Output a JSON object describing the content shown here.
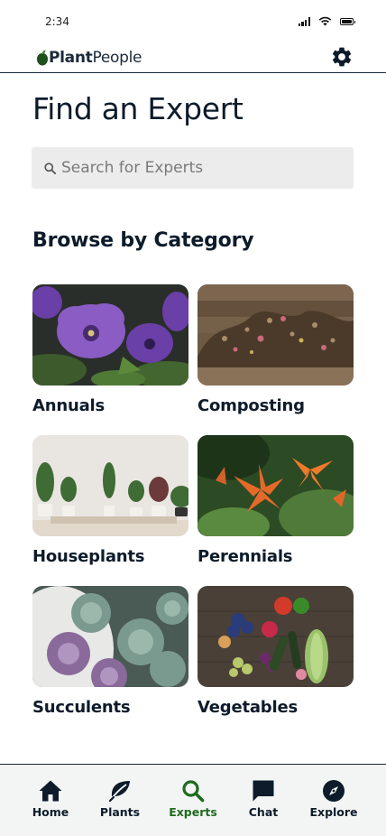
{
  "status_bar": {
    "time": "2:34"
  },
  "header": {
    "logo_part1": "Plant",
    "logo_part2": "People"
  },
  "main": {
    "title": "Find an Expert",
    "search": {
      "placeholder": "Search for Experts",
      "value": ""
    },
    "section_title": "Browse by Category",
    "categories": [
      {
        "label": "Annuals"
      },
      {
        "label": "Composting"
      },
      {
        "label": "Houseplants"
      },
      {
        "label": "Perennials"
      },
      {
        "label": "Succulents"
      },
      {
        "label": "Vegetables"
      }
    ]
  },
  "bottom_nav": {
    "items": [
      {
        "label": "Home",
        "icon": "home-icon"
      },
      {
        "label": "Plants",
        "icon": "leaf-icon"
      },
      {
        "label": "Experts",
        "icon": "search-icon",
        "active": true
      },
      {
        "label": "Chat",
        "icon": "chat-icon"
      },
      {
        "label": "Explore",
        "icon": "compass-icon"
      }
    ]
  },
  "colors": {
    "primary_text": "#0d1b2a",
    "active_nav": "#1f6b1d",
    "nav_bg": "#f2f5f4",
    "search_bg": "#ececec"
  }
}
